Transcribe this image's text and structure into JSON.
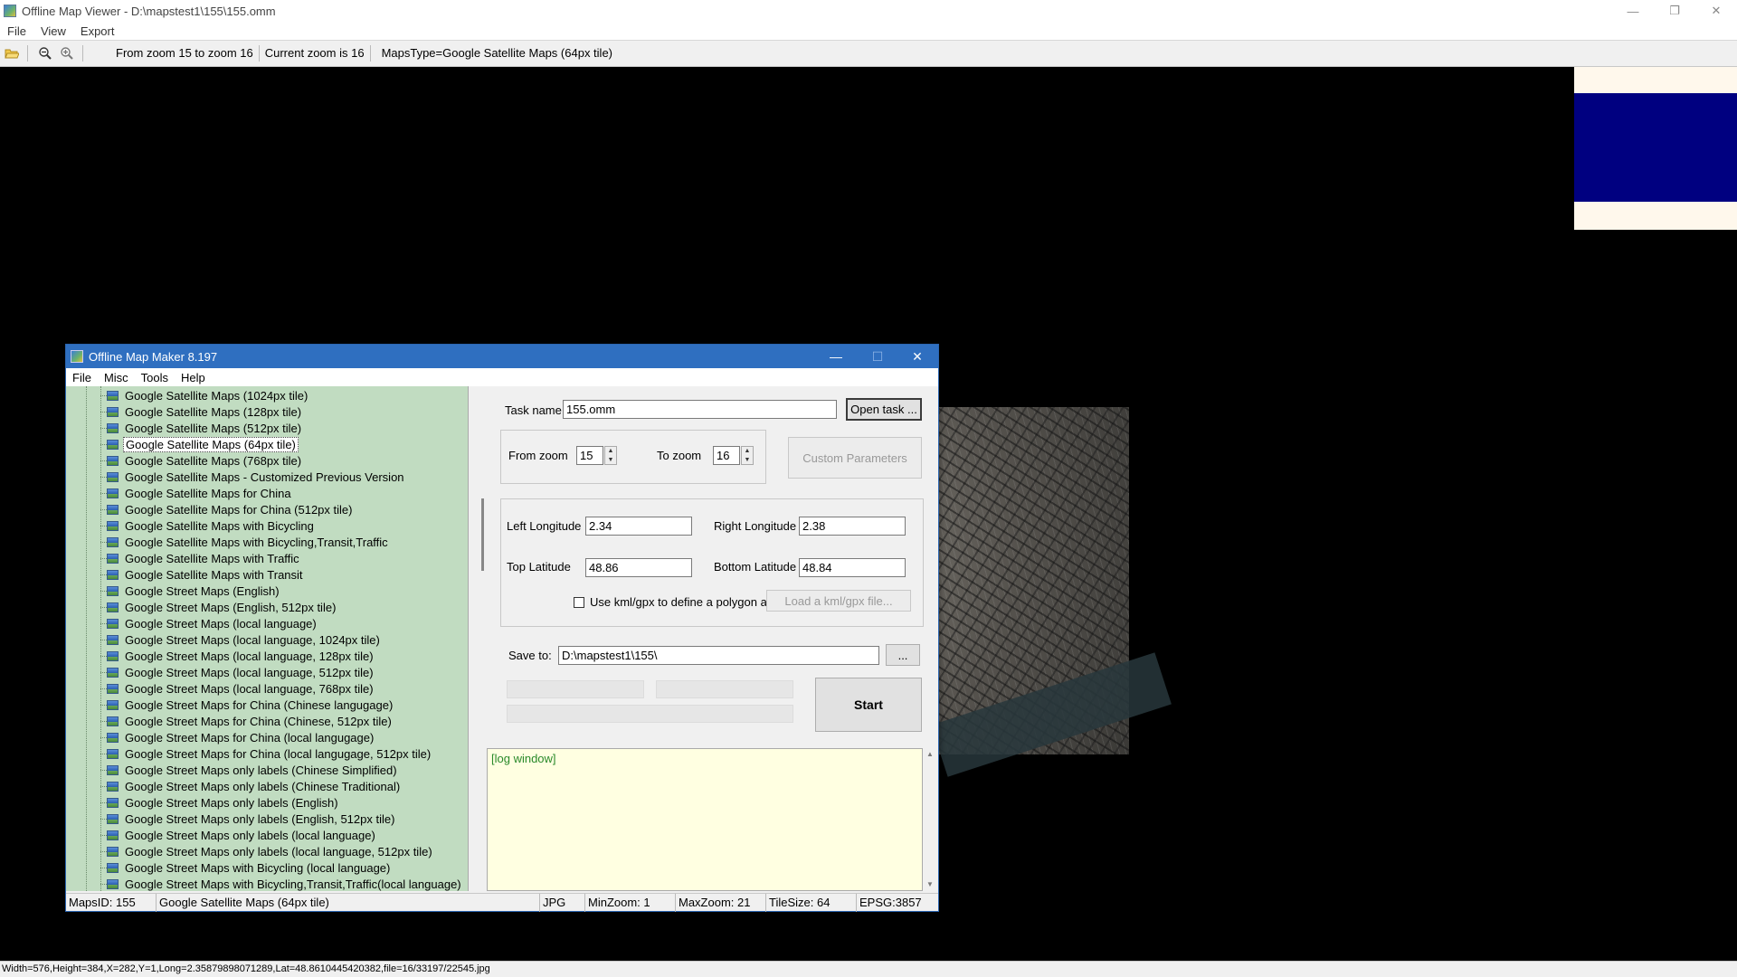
{
  "window": {
    "title": "Offline Map Viewer - D:\\mapstest1\\155\\155.omm",
    "controls": [
      "—",
      "❐",
      "✕"
    ]
  },
  "menu": [
    "File",
    "View",
    "Export"
  ],
  "toolbar": {
    "icons": [
      "open-folder-icon",
      "zoom-out-icon",
      "zoom-in-icon"
    ],
    "zoom_range": "From zoom 15 to zoom 16",
    "current_zoom": "Current zoom is 16",
    "maps_type": "MapsType=Google Satellite Maps (64px tile)"
  },
  "statusbar": "Width=576,Height=384,X=282,Y=1,Long=2.35879898071289,Lat=48.8610445420382,file=16/33197/22545.jpg",
  "dialog": {
    "title": "Offline Map Maker 8.197",
    "controls": [
      "—",
      "☐",
      "✕"
    ],
    "menu": [
      "File",
      "Misc",
      "Tools",
      "Help"
    ],
    "tree_items": [
      "Google Satellite Maps (1024px tile)",
      "Google Satellite Maps (128px tile)",
      "Google Satellite Maps (512px tile)",
      "Google Satellite Maps (64px tile)",
      "Google Satellite Maps (768px tile)",
      "Google Satellite Maps - Customized Previous Version",
      "Google Satellite Maps for China",
      "Google Satellite Maps for China (512px tile)",
      "Google Satellite Maps with Bicycling",
      "Google Satellite Maps with Bicycling,Transit,Traffic",
      "Google Satellite Maps with Traffic",
      "Google Satellite Maps with Transit",
      "Google Street Maps (English)",
      "Google Street Maps (English, 512px tile)",
      "Google Street Maps (local language)",
      "Google Street Maps (local language, 1024px tile)",
      "Google Street Maps (local language, 128px tile)",
      "Google Street Maps (local language, 512px tile)",
      "Google Street Maps (local language, 768px tile)",
      "Google Street Maps for China (Chinese langugage)",
      "Google Street Maps for China (Chinese, 512px tile)",
      "Google Street Maps for China (local langugage)",
      "Google Street Maps for China (local langugage, 512px tile)",
      "Google Street Maps only labels (Chinese Simplified)",
      "Google Street Maps only labels (Chinese Traditional)",
      "Google Street Maps only labels (English)",
      "Google Street Maps only labels (English, 512px tile)",
      "Google Street Maps only labels (local language)",
      "Google Street Maps only labels (local language, 512px tile)",
      "Google Street Maps with Bicycling (local language)",
      "Google Street Maps with Bicycling,Transit,Traffic(local language)"
    ],
    "selected_item": "Google Satellite Maps (64px tile)",
    "form": {
      "task_name_label": "Task name",
      "task_name_value": "155.omm",
      "open_task_label": "Open task ...",
      "from_zoom_label": "From zoom",
      "from_zoom_value": "15",
      "to_zoom_label": "To zoom",
      "to_zoom_value": "16",
      "custom_params_label": "Custom Parameters",
      "left_lon_label": "Left Longitude",
      "left_lon_value": "2.34",
      "right_lon_label": "Right Longitude",
      "right_lon_value": "2.38",
      "top_lat_label": "Top Latitude",
      "top_lat_value": "48.86",
      "bottom_lat_label": "Bottom Latitude",
      "bottom_lat_value": "48.84",
      "kml_checkbox_label": "Use kml/gpx to define a polygon area",
      "kml_checked": false,
      "load_kml_label": "Load a kml/gpx file...",
      "save_to_label": "Save to:",
      "save_to_value": "D:\\mapstest1\\155\\",
      "browse_label": "...",
      "start_label": "Start"
    },
    "log_text": "[log window]",
    "status": {
      "maps_id": "MapsID: 155",
      "map_name": "Google Satellite Maps (64px tile)",
      "format": "JPG",
      "min_zoom": "MinZoom: 1",
      "max_zoom": "MaxZoom: 21",
      "tile_size": "TileSize: 64",
      "epsg": "EPSG:3857"
    }
  },
  "colors": {
    "tree_bg": "#c1dcc1",
    "log_bg": "#ffffe1",
    "dialog_title": "#2f6fc0",
    "log_text": "#2a8a2a"
  }
}
